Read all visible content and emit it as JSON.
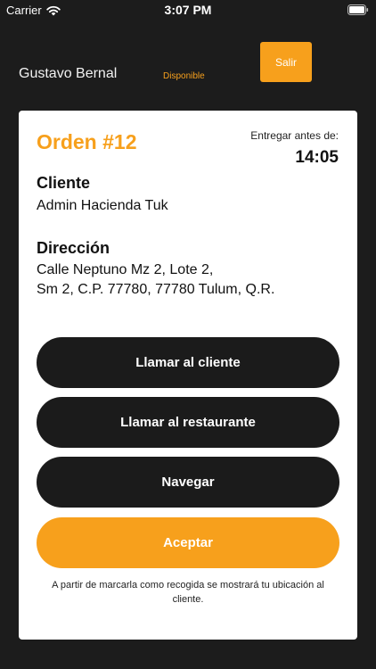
{
  "status_bar": {
    "carrier": "Carrier",
    "time": "3:07 PM"
  },
  "header": {
    "driver_name": "Gustavo Bernal",
    "status": "Disponible",
    "logout_label": "Salir"
  },
  "order": {
    "title": "Orden #12",
    "deliver_before_label": "Entregar antes de:",
    "deliver_before_time": "14:05",
    "client_heading": "Cliente",
    "client_name": "Admin Hacienda Tuk",
    "address_heading": "Dirección",
    "address_line1": "Calle Neptuno Mz 2, Lote 2,",
    "address_line2": "Sm 2, C.P. 77780, 77780 Tulum, Q.R."
  },
  "actions": {
    "call_client": "Llamar al cliente",
    "call_restaurant": "Llamar al restaurante",
    "navigate": "Navegar",
    "accept": "Aceptar"
  },
  "footer_note": "A partir de marcarla como recogida se mostrará tu ubicación al cliente.",
  "colors": {
    "background": "#1c1c1c",
    "accent": "#f7a01c",
    "card": "#ffffff",
    "button_dark": "#1b1b1b"
  },
  "icons": {
    "wifi": "wifi-icon",
    "battery": "battery-icon"
  }
}
